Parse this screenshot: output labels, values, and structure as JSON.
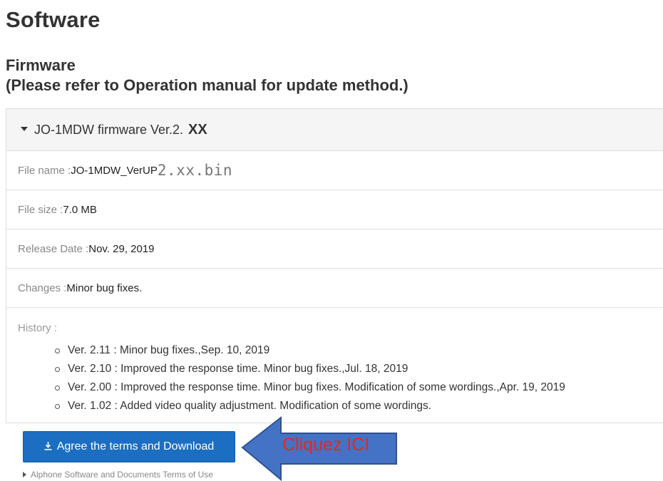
{
  "headings": {
    "software": "Software",
    "firmware_line1": "Firmware",
    "firmware_line2": "(Please refer to Operation manual for update method.)"
  },
  "panel": {
    "title_main": "JO-1MDW firmware Ver.2.",
    "title_suffix": "XX",
    "file_name_label": "File name : ",
    "file_name_value": "JO-1MDW_VerUP",
    "file_name_suffix": "2.xx.bin",
    "file_size_label": "File size : ",
    "file_size_value": "7.0 MB",
    "release_date_label": "Release Date : ",
    "release_date_value": "Nov. 29, 2019",
    "changes_label": "Changes : ",
    "changes_value": "Minor bug fixes.",
    "history_label": "History :",
    "history": [
      "Ver. 2.11 : Minor bug fixes.,Sep. 10, 2019",
      "Ver. 2.10 : Improved the response time. Minor bug fixes.,Jul. 18, 2019",
      "Ver. 2.00 : Improved the response time. Minor bug fixes. Modification of some wordings.,Apr. 19, 2019",
      "Ver. 1.02 : Added video quality adjustment. Modification of some wordings."
    ]
  },
  "download_button": {
    "icon": "download-icon",
    "label": "Agree the terms and Download",
    "color": "#1b6ec2"
  },
  "terms_link": "Alphone Software and Documents Terms of Use",
  "annotation": {
    "text": "Cliquez ICI",
    "arrow_color": "#4472c4",
    "text_color": "#e8261f"
  }
}
